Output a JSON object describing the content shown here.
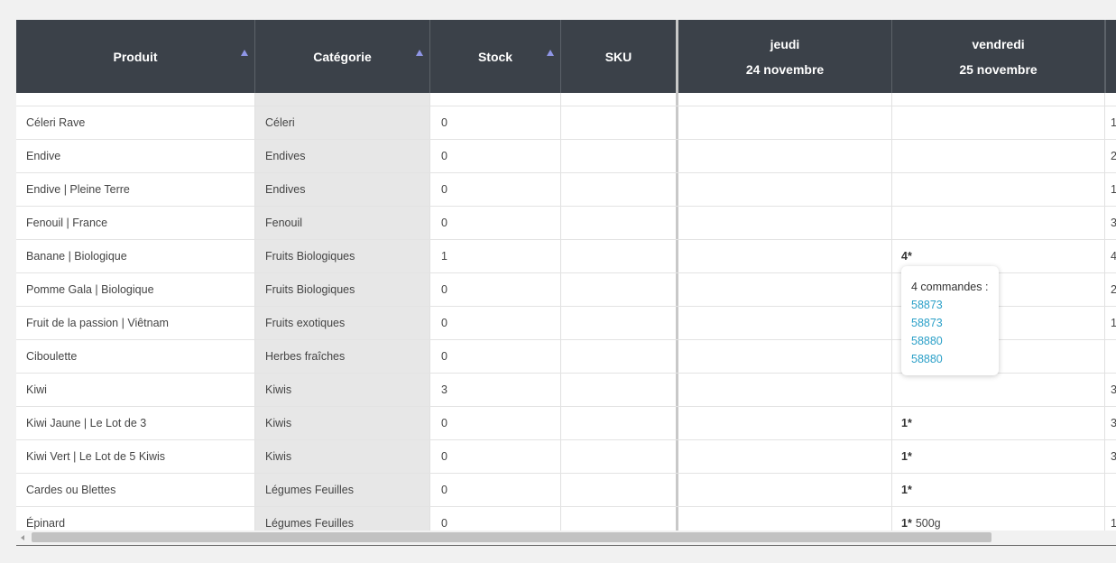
{
  "columns": [
    {
      "key": "produit",
      "label": "Produit",
      "sortable": true
    },
    {
      "key": "categorie",
      "label": "Catégorie",
      "sortable": true
    },
    {
      "key": "stock",
      "label": "Stock",
      "sortable": true
    },
    {
      "key": "sku",
      "label": "SKU",
      "sortable": false
    },
    {
      "key": "jeudi",
      "label": "jeudi",
      "sublabel": "24 novembre"
    },
    {
      "key": "vendredi",
      "label": "vendredi",
      "sublabel": "25 novembre"
    }
  ],
  "rows": [
    {
      "produit": "Céleri Rave",
      "categorie": "Céleri",
      "stock": "0",
      "jeudi": "",
      "vendredi": "",
      "vendredi_note": "",
      "next": "1"
    },
    {
      "produit": "Endive",
      "categorie": "Endives",
      "stock": "0",
      "jeudi": "",
      "vendredi": "",
      "vendredi_note": "",
      "next": "2"
    },
    {
      "produit": "Endive | Pleine Terre",
      "categorie": "Endives",
      "stock": "0",
      "jeudi": "",
      "vendredi": "",
      "vendredi_note": "",
      "next": "1"
    },
    {
      "produit": "Fenouil | France",
      "categorie": "Fenouil",
      "stock": "0",
      "jeudi": "",
      "vendredi": "",
      "vendredi_note": "",
      "next": "3"
    },
    {
      "produit": "Banane | Biologique",
      "categorie": "Fruits Biologiques",
      "stock": "1",
      "jeudi": "",
      "vendredi": "4*",
      "vendredi_note": "",
      "next": "4"
    },
    {
      "produit": "Pomme Gala | Biologique",
      "categorie": "Fruits Biologiques",
      "stock": "0",
      "jeudi": "",
      "vendredi": "",
      "vendredi_note": "",
      "next": "2"
    },
    {
      "produit": "Fruit de la passion | Viêtnam",
      "categorie": "Fruits exotiques",
      "stock": "0",
      "jeudi": "",
      "vendredi": "",
      "vendredi_note": "",
      "next": "1"
    },
    {
      "produit": "Ciboulette",
      "categorie": "Herbes fraîches",
      "stock": "0",
      "jeudi": "",
      "vendredi": "",
      "vendredi_note": "",
      "next": ""
    },
    {
      "produit": "Kiwi",
      "categorie": "Kiwis",
      "stock": "3",
      "jeudi": "",
      "vendredi": "",
      "vendredi_note": "",
      "next": "3"
    },
    {
      "produit": "Kiwi Jaune | Le Lot de 3",
      "categorie": "Kiwis",
      "stock": "0",
      "jeudi": "",
      "vendredi": "1*",
      "vendredi_note": "",
      "next": "3"
    },
    {
      "produit": "Kiwi Vert | Le Lot de 5 Kiwis",
      "categorie": "Kiwis",
      "stock": "0",
      "jeudi": "",
      "vendredi": "1*",
      "vendredi_note": "",
      "next": "3"
    },
    {
      "produit": "Cardes ou Blettes",
      "categorie": "Légumes Feuilles",
      "stock": "0",
      "jeudi": "",
      "vendredi": "1*",
      "vendredi_note": "",
      "next": ""
    },
    {
      "produit": "Épinard",
      "categorie": "Légumes Feuilles",
      "stock": "0",
      "jeudi": "",
      "vendredi": "1*",
      "vendredi_note": "500g",
      "next": "1"
    }
  ],
  "tooltip": {
    "title": "4 commandes :",
    "orders": [
      "58873",
      "58873",
      "58880",
      "58880"
    ]
  },
  "colors": {
    "header_bg": "#3b4149",
    "sort_arrow": "#8f96e6",
    "link": "#2ca0c8",
    "category_bg": "#e7e7e7"
  }
}
